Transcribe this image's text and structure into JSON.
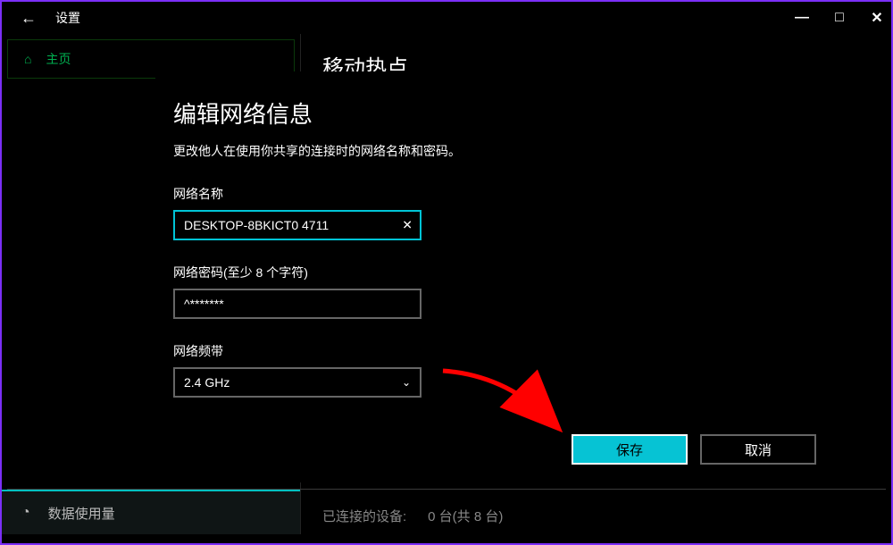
{
  "titlebar": {
    "back_label": "←",
    "title": "设置",
    "minimize": "—",
    "maximize": "□",
    "close": "✕"
  },
  "sidebar": {
    "home_label": "主页",
    "data_usage_label": "数据使用量"
  },
  "main": {
    "heading": "移动热点",
    "connected_label": "已连接的设备:",
    "connected_value": "0 台(共 8 台)"
  },
  "dialog": {
    "title": "编辑网络信息",
    "subtitle": "更改他人在使用你共享的连接时的网络名称和密码。",
    "network_name_label": "网络名称",
    "network_name_value": "DESKTOP-8BKICT0 4711",
    "network_password_label": "网络密码(至少 8 个字符)",
    "network_password_value": "^*******",
    "network_band_label": "网络频带",
    "network_band_value": "2.4 GHz",
    "save_label": "保存",
    "cancel_label": "取消"
  }
}
